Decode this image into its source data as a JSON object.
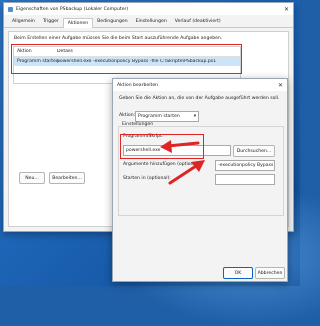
{
  "main_window": {
    "title": "Eigenschaften von PSbackup (Lokaler Computer)",
    "tabs": [
      "Allgemein",
      "Trigger",
      "Aktionen",
      "Bedingungen",
      "Einstellungen",
      "Verlauf (deaktiviert)"
    ],
    "active_tab": "Aktionen",
    "description": "Beim Erstellen einer Aufgabe müssen Sie die beim Start auszuführende Aufgabe angeben.",
    "table": {
      "headers": [
        "Aktion",
        "Details"
      ],
      "rows": [
        {
          "action": "Programm starten",
          "details": "powershell.exe -executionpolicy Bypass -file C:\\Skripte\\PSbackup.ps1"
        }
      ]
    },
    "buttons": {
      "new": "Neu...",
      "edit": "Bearbeiten..."
    }
  },
  "dialog": {
    "title": "Aktion bearbeiten",
    "description": "Geben Sie die Aktion an, die von der Aufgabe ausgeführt werden soll.",
    "action_label": "Aktion:",
    "action_value": "Programm starten",
    "settings_label": "Einstellungen",
    "program_label": "Programm/Skript:",
    "program_value": "powershell.exe",
    "browse_button": "Durchsuchen...",
    "args_label": "Argumente hinzufügen (optional):",
    "args_value": "-executionpolicy Bypass",
    "start_label": "Starten in (optional):",
    "start_value": "",
    "ok_button": "OK",
    "cancel_button": "Abbrechen"
  },
  "colors": {
    "highlight": "#e02424",
    "selection": "#cce4f7",
    "accent": "#0a64c8"
  }
}
